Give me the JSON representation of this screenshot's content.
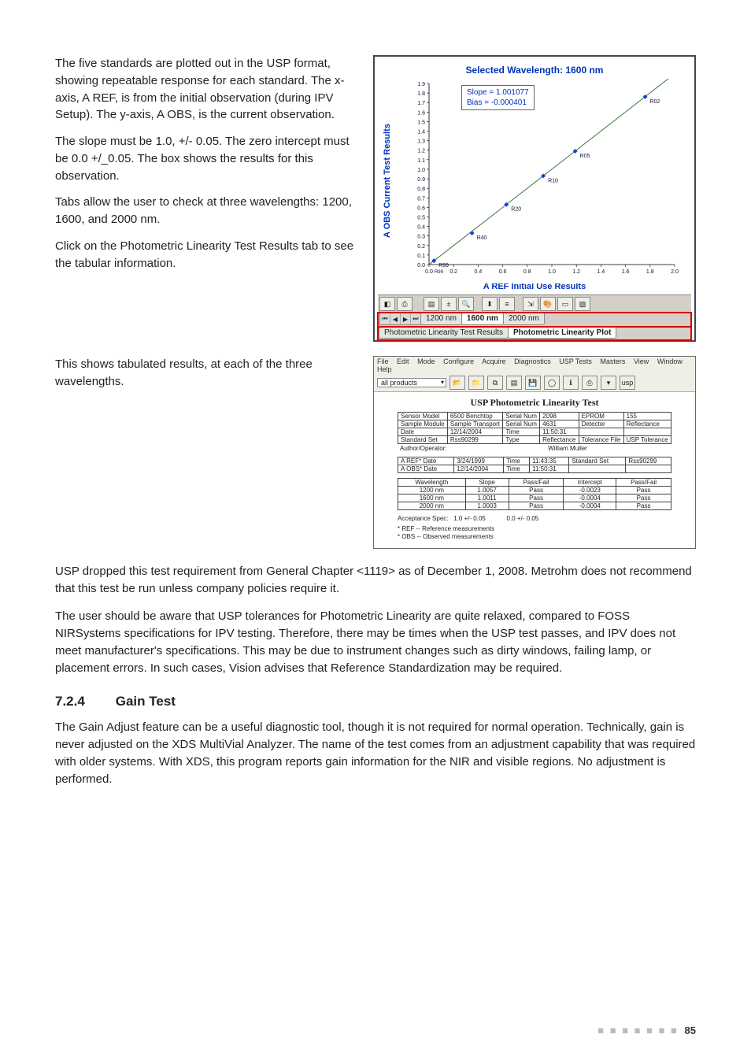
{
  "para1": "The five standards are plotted out in the USP format, showing repeatable response for each standard. The x-axis, A REF, is from the initial observation (during IPV Setup). The y-axis, A OBS, is the current observation.",
  "para2": "The slope must be 1.0, +/- 0.05. The zero intercept must be 0.0 +/_0.05. The box shows the results for this observation.",
  "para3": "Tabs allow the user to check at three wavelengths: 1200, 1600, and 2000 nm.",
  "para4": "Click on the Photometric Linearity Test Results tab to see the tabular information.",
  "para5": "This shows tabulated results, at each of the three wavelengths.",
  "below1": "USP dropped this test requirement from General Chapter <1119> as of December 1, 2008. Metrohm does not recommend that this test be run unless company policies require it.",
  "below2": "The user should be aware that USP tolerances for Photometric Linearity are quite relaxed, compared to FOSS NIRSystems specifications for IPV testing. Therefore, there may be times when the USP test passes, and IPV does not meet manufacturer's specifications. This may be due to instrument changes such as dirty windows, failing lamp, or placement errors. In such cases, Vision advises that Reference Standardization may be required.",
  "sectionNum": "7.2.4",
  "sectionTitle": "Gain Test",
  "gainPara": "The Gain Adjust feature can be a useful diagnostic tool, though it is not required for normal operation. Technically, gain is never adjusted on the XDS MultiVial Analyzer. The name of the test comes from an adjustment capability that was required with older systems. With XDS, this program reports gain information for the NIR and visible regions. No adjustment is performed.",
  "pageNum": "85",
  "chart_data": {
    "type": "scatter",
    "title": "Selected Wavelength: 1600 nm",
    "xlabel": "A REF Initial Use Results",
    "ylabel": "A OBS Current Test Results",
    "xlim": [
      0.0,
      2.0
    ],
    "ylim": [
      0.0,
      1.9
    ],
    "xticks": [
      "0.0",
      "0.2",
      "0.4",
      "0.6",
      "0.8",
      "1.0",
      "1.2",
      "1.4",
      "1.6",
      "1.8",
      "2.0"
    ],
    "yticks": [
      "0.0",
      "0.1",
      "0.2",
      "0.3",
      "0.4",
      "0.5",
      "0.6",
      "0.7",
      "0.8",
      "0.9",
      "1.0",
      "1.1",
      "1.2",
      "1.3",
      "1.4",
      "1.5",
      "1.6",
      "1.7",
      "1.8",
      "1.9"
    ],
    "slope_text": "Slope = 1.001077",
    "bias_text": "Bias = -0.000401",
    "extra_xlabel": "R99",
    "points": [
      {
        "label": "R99",
        "x": 0.04,
        "y": 0.04
      },
      {
        "label": "R40",
        "x": 0.35,
        "y": 0.33
      },
      {
        "label": "R20",
        "x": 0.63,
        "y": 0.63
      },
      {
        "label": "R10",
        "x": 0.93,
        "y": 0.93
      },
      {
        "label": "R05",
        "x": 1.19,
        "y": 1.19
      },
      {
        "label": "R02",
        "x": 1.76,
        "y": 1.76
      }
    ]
  },
  "chartTabs": {
    "t1": "1200 nm",
    "t2": "1600 nm",
    "t3": "2000 nm",
    "r1": "Photometric Linearity Test Results",
    "r2": "Photometric Linearity Plot"
  },
  "menu": {
    "file": "File",
    "edit": "Edit",
    "mode": "Mode",
    "configure": "Configure",
    "acquire": "Acquire",
    "diagnostics": "Diagnostics",
    "usp": "USP Tests",
    "masters": "Masters",
    "view": "View",
    "window": "Window",
    "help": "Help"
  },
  "results": {
    "dropdown": "all products",
    "title": "USP Photometric Linearity Test",
    "header1": [
      [
        "Sensor Model",
        "6500 Benchtop",
        "Serial Num",
        "2098",
        "EPROM",
        "155"
      ],
      [
        "Sample Module",
        "Sample Transport",
        "Serial Num",
        "4631",
        "Detector",
        "Reflectance"
      ],
      [
        "Date",
        "12/14/2004",
        "Time",
        "11:50:31",
        "",
        ""
      ],
      [
        "Standard Set",
        "Rss90299",
        "Type",
        "Reflectance",
        "Tolerance File",
        "USP Tolerance"
      ]
    ],
    "authorLine": [
      "Author/Operator:",
      "William Muller"
    ],
    "dates": [
      [
        "A REF* Date",
        "3/24/1999",
        "Time",
        "11:43:35",
        "Standard Set",
        "Rss90299"
      ],
      [
        "A OBS* Date",
        "12/14/2004",
        "Time",
        "11:50:31",
        "",
        ""
      ]
    ],
    "results_header": [
      "Wavelength",
      "Slope",
      "Pass/Fail",
      "Intercept",
      "Pass/Fail"
    ],
    "results_rows": [
      [
        "1200 nm",
        "1.0057",
        "Pass",
        "-0.0023",
        "Pass"
      ],
      [
        "1600 nm",
        "1.0011",
        "Pass",
        "-0.0004",
        "Pass"
      ],
      [
        "2000 nm",
        "1.0003",
        "Pass",
        "-0.0004",
        "Pass"
      ]
    ],
    "spec": [
      "Acceptance Spec:",
      "1.0 +/- 0.05",
      "0.0 +/- 0.05"
    ],
    "foot1": "* REF -- Reference measurements",
    "foot2": "* OBS -- Observed measurements"
  }
}
